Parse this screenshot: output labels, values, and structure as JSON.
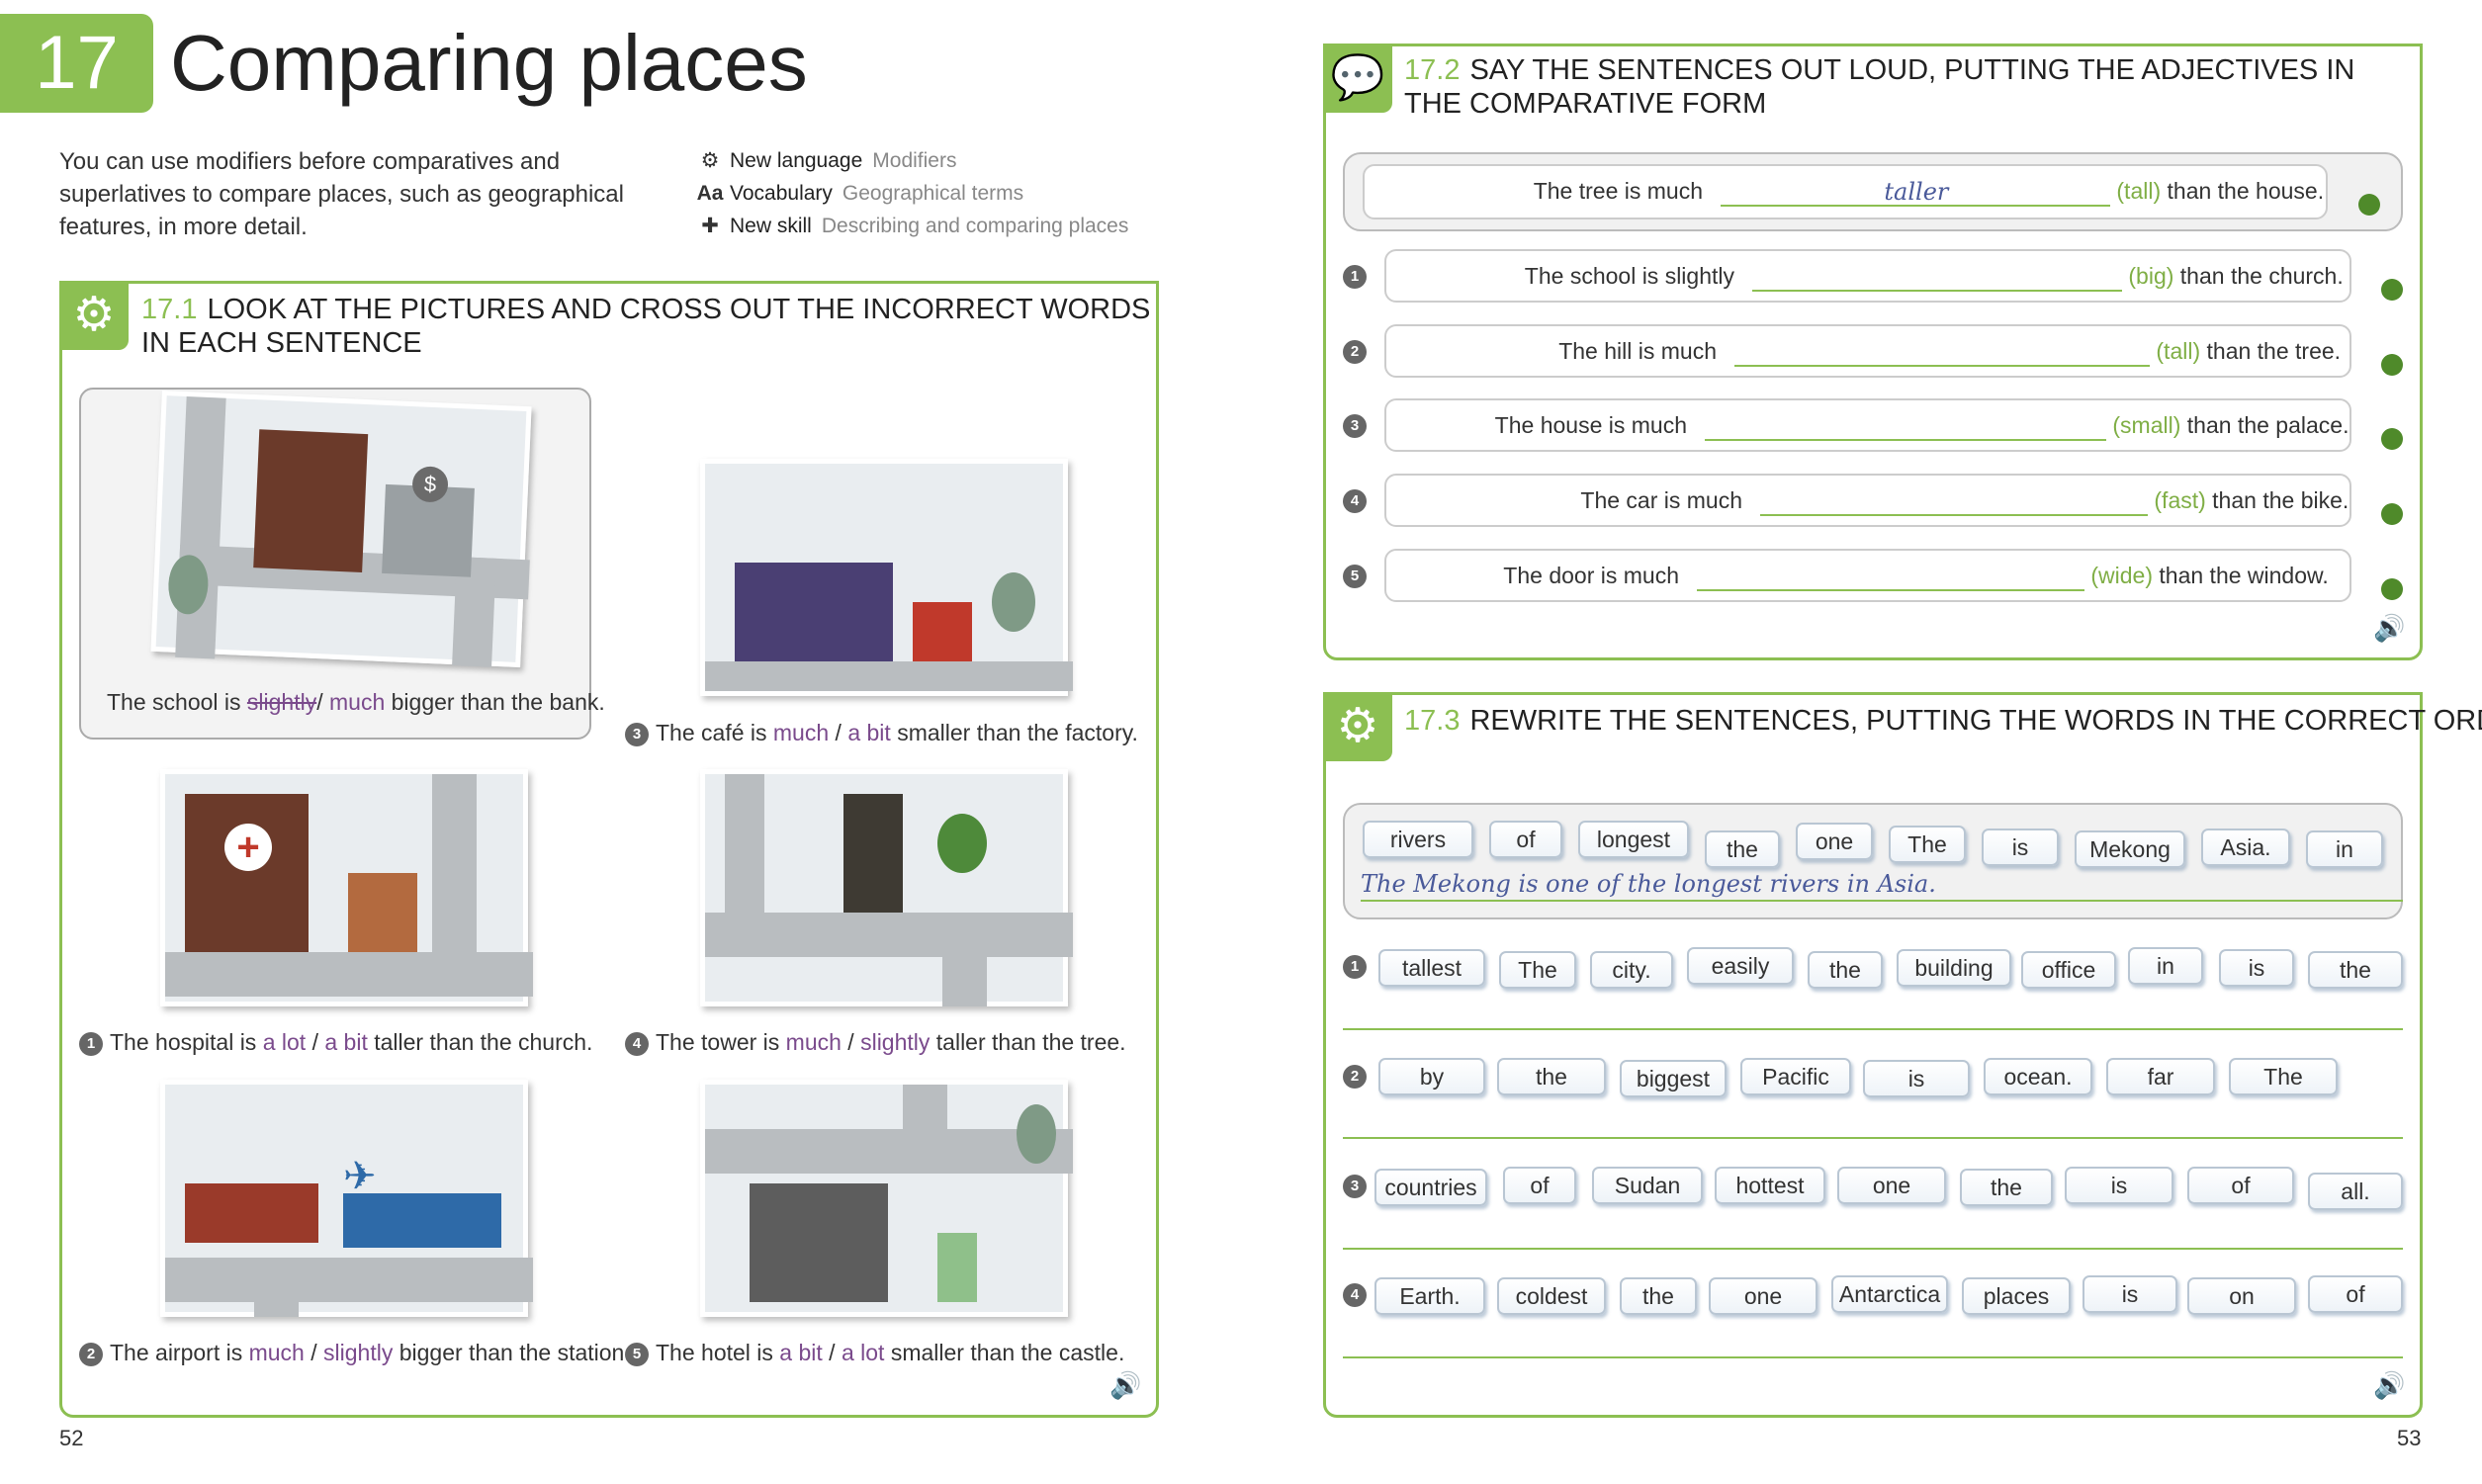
{
  "header": {
    "chapter_number": "17",
    "chapter_title": "Comparing places",
    "intro": "You can use modifiers before comparatives and superlatives to compare places, such as geographical features, in more detail."
  },
  "meta": [
    {
      "icon": "gear-icon",
      "label": "New language",
      "value": "Modifiers"
    },
    {
      "icon": "aa-icon",
      "label": "Vocabulary",
      "value": "Geographical terms"
    },
    {
      "icon": "puzzle-icon",
      "label": "New skill",
      "value": "Describing and comparing places"
    }
  ],
  "ex1": {
    "number": "17.1",
    "title_line1": "LOOK AT THE PICTURES AND CROSS OUT THE INCORRECT WORDS",
    "title_line2": "IN EACH SENTENCE",
    "example": {
      "pre": "The school is",
      "opt1": "slightly",
      "sep": "/",
      "opt2": "much",
      "post": "bigger than the bank."
    },
    "items": [
      {
        "n": "1",
        "pre": "The hospital is",
        "opt1": "a lot",
        "sep": "/",
        "opt2": "a bit",
        "post": "taller than the church."
      },
      {
        "n": "2",
        "pre": "The airport is",
        "opt1": "much",
        "sep": "/",
        "opt2": "slightly",
        "post": "bigger than the station."
      },
      {
        "n": "3",
        "pre": "The café is",
        "opt1": "much",
        "sep": "/",
        "opt2": "a bit",
        "post": "smaller than the factory."
      },
      {
        "n": "4",
        "pre": "The tower is",
        "opt1": "much",
        "sep": "/",
        "opt2": "slightly",
        "post": "taller than the tree."
      },
      {
        "n": "5",
        "pre": "The hotel is",
        "opt1": "a bit",
        "sep": "/",
        "opt2": "a lot",
        "post": "smaller than the castle."
      }
    ]
  },
  "ex2": {
    "number": "17.2",
    "title_line1": "SAY THE SENTENCES OUT LOUD, PUTTING THE ADJECTIVES IN",
    "title_line2": "THE COMPARATIVE FORM",
    "example": {
      "pre": "The tree is much",
      "answer": "taller",
      "adj": "(tall)",
      "post": "than the house."
    },
    "items": [
      {
        "n": "1",
        "pre": "The school is slightly",
        "adj": "(big)",
        "post": "than the church."
      },
      {
        "n": "2",
        "pre": "The hill is much",
        "adj": "(tall)",
        "post": "than the tree."
      },
      {
        "n": "3",
        "pre": "The house is much",
        "adj": "(small)",
        "post": "than the palace."
      },
      {
        "n": "4",
        "pre": "The car is much",
        "adj": "(fast)",
        "post": "than the bike."
      },
      {
        "n": "5",
        "pre": "The door is much",
        "adj": "(wide)",
        "post": "than the window."
      }
    ]
  },
  "ex3": {
    "number": "17.3",
    "title": "REWRITE THE SENTENCES, PUTTING THE WORDS IN THE CORRECT ORDER",
    "example": {
      "words": [
        "rivers",
        "of",
        "longest",
        "the",
        "one",
        "The",
        "is",
        "Mekong",
        "Asia.",
        "in"
      ],
      "answer": "The Mekong is one of the longest rivers in Asia."
    },
    "items": [
      {
        "n": "1",
        "words": [
          "tallest",
          "The",
          "city.",
          "easily",
          "the",
          "building",
          "office",
          "in",
          "is",
          "the"
        ]
      },
      {
        "n": "2",
        "words": [
          "by",
          "the",
          "biggest",
          "Pacific",
          "is",
          "ocean.",
          "far",
          "The"
        ]
      },
      {
        "n": "3",
        "words": [
          "countries",
          "of",
          "Sudan",
          "hottest",
          "one",
          "the",
          "is",
          "of",
          "all."
        ]
      },
      {
        "n": "4",
        "words": [
          "Earth.",
          "coldest",
          "the",
          "one",
          "Antarctica",
          "places",
          "is",
          "on",
          "of"
        ]
      }
    ]
  },
  "pages": {
    "left": "52",
    "right": "53"
  }
}
